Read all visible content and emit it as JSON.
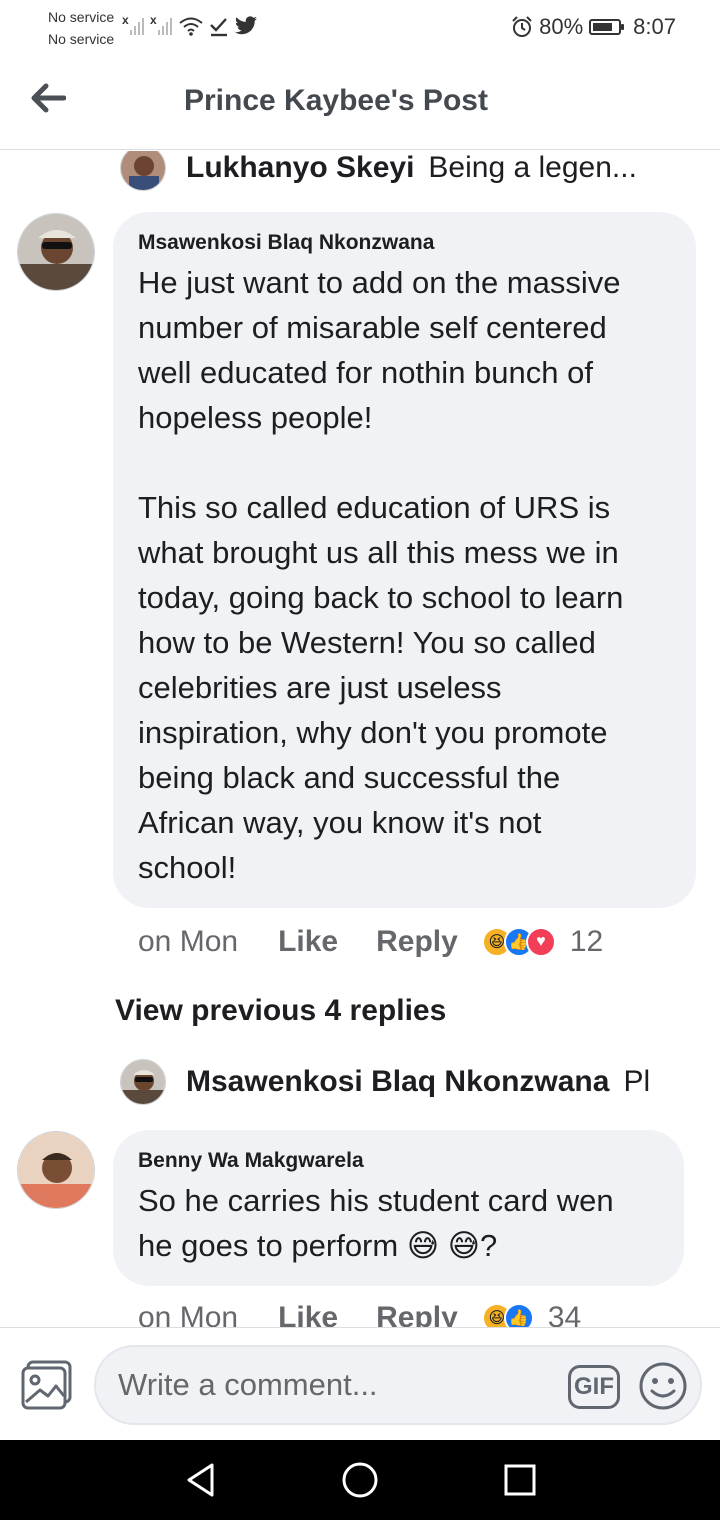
{
  "status_bar": {
    "service_line_1": "No service",
    "service_line_2": "No service",
    "signal_x": "x",
    "battery_percent": "80%",
    "battery_level": 0.8,
    "time": "8:07",
    "icons": [
      "signal-icon",
      "signal-icon",
      "wifi-icon",
      "check-download-icon",
      "twitter-icon",
      "alarm-icon",
      "battery-icon"
    ]
  },
  "header": {
    "title": "Prince Kaybee's Post",
    "back_icon": "back-arrow-icon"
  },
  "reply_preview_1": {
    "name": "Lukhanyo Skeyi",
    "text": "Being a legen..."
  },
  "comment_1": {
    "author": "Msawenkosi Blaq Nkonzwana",
    "text": "He just want to add on the massive\nnumber of misarable self centered\nwell educated for nothin bunch of\nhopeless people!\n\nThis so called education of URS is\nwhat brought us all this mess we in\ntoday, going back to school to learn\nhow to be Western! You so called\ncelebrities are just useless\ninspiration, why don't you promote\nbeing black and successful the\nAfrican way, you know it's not\nschool!",
    "time": "on Mon",
    "like_label": "Like",
    "reply_label": "Reply",
    "reactions": [
      "haha",
      "like",
      "love"
    ],
    "reaction_count": "12"
  },
  "view_previous": "View previous 4 replies",
  "reply_preview_2": {
    "name": "Msawenkosi Blaq Nkonzwana",
    "text": "Pl"
  },
  "comment_2": {
    "author": "Benny Wa Makgwarela",
    "text": "So he carries his student card wen\nhe goes to perform 😅 😅?",
    "time": "on Mon",
    "like_label": "Like",
    "reply_label": "Reply",
    "reactions": [
      "haha",
      "like"
    ],
    "reaction_count": "34"
  },
  "composer": {
    "placeholder": "Write a comment...",
    "gif_label": "GIF"
  },
  "nav_bar": {
    "icons": [
      "back-triangle-icon",
      "home-circle-icon",
      "recents-square-icon"
    ]
  }
}
